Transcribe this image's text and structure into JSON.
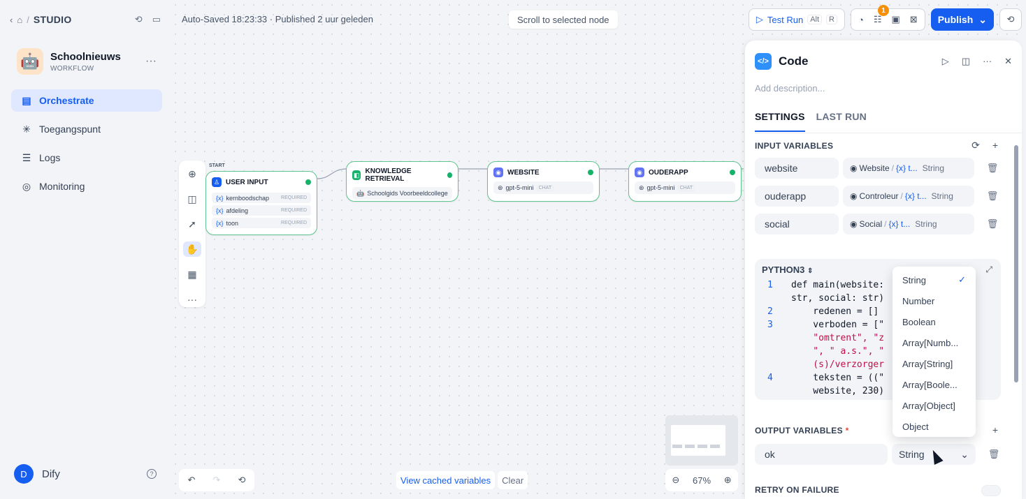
{
  "sidebar": {
    "studio_label": "STUDIO",
    "app": {
      "name": "Schoolnieuws",
      "type": "WORKFLOW",
      "emoji": "🤖"
    },
    "nav": [
      {
        "label": "Orchestrate",
        "icon": "orchestrate-icon",
        "active": true
      },
      {
        "label": "Toegangspunt",
        "icon": "access-point-icon",
        "active": false
      },
      {
        "label": "Logs",
        "icon": "logs-icon",
        "active": false
      },
      {
        "label": "Monitoring",
        "icon": "monitoring-icon",
        "active": false
      }
    ],
    "user": {
      "initial": "D",
      "name": "Dify"
    }
  },
  "topbar": {
    "status": "Auto-Saved 18:23:33 · Published 2 uur geleden",
    "scroll_to_node": "Scroll to selected node",
    "test_run": "Test Run",
    "kbd_alt": "Alt",
    "kbd_r": "R",
    "badge_count": "1",
    "publish": "Publish"
  },
  "canvas": {
    "start_label": "START",
    "nodes": {
      "user_input": {
        "title": "USER INPUT",
        "vars": [
          {
            "name": "kernboodschap",
            "req": "REQUIRED"
          },
          {
            "name": "afdeling",
            "req": "REQUIRED"
          },
          {
            "name": "toon",
            "req": "REQUIRED"
          }
        ]
      },
      "knowledge": {
        "title": "KNOWLEDGE RETRIEVAL",
        "sub": "Schoolgids Voorbeeldcollege"
      },
      "website": {
        "title": "WEBSITE",
        "model": "gpt-5-mini",
        "chip": "CHAT"
      },
      "ouderapp": {
        "title": "OUDERAPP",
        "model": "gpt-5-mini",
        "chip": "CHAT"
      }
    },
    "cache": {
      "view": "View cached variables",
      "clear": "Clear"
    },
    "zoom": "67%"
  },
  "panel": {
    "title": "Code",
    "description_placeholder": "Add description...",
    "tabs": [
      "SETTINGS",
      "LAST RUN"
    ],
    "input_label": "INPUT VARIABLES",
    "inputs": [
      {
        "name": "website",
        "node": "Website",
        "var": "{x} t...",
        "type": "String"
      },
      {
        "name": "ouderapp",
        "node": "Controleur",
        "var": "{x} t...",
        "type": "String"
      },
      {
        "name": "social",
        "node": "Social",
        "var": "{x} t...",
        "type": "String"
      }
    ],
    "code": {
      "language": "PYTHON3",
      "lines": [
        {
          "n": "1",
          "text": "def main(website:"
        },
        {
          "n": "",
          "text": "str, social: str)"
        },
        {
          "n": "2",
          "text": "    redenen = []"
        },
        {
          "n": "3",
          "text": "    verboden = [\""
        },
        {
          "n": "",
          "text": "    \"omtrent\", \"z"
        },
        {
          "n": "",
          "text": "    \", \" a.s.\", \""
        },
        {
          "n": "",
          "text": "    (s)/verzorger"
        },
        {
          "n": "4",
          "text": "    teksten = ((\""
        },
        {
          "n": "",
          "text": "    website, 230)"
        }
      ]
    },
    "output_label": "OUTPUT VARIABLES",
    "output_star": "*",
    "output": {
      "name": "ok",
      "type": "String"
    },
    "retry_label": "RETRY ON FAILURE"
  },
  "type_dropdown": {
    "selected": "String",
    "options": [
      "String",
      "Number",
      "Boolean",
      "Array[Numb...",
      "Array[String]",
      "Array[Boole...",
      "Array[Object]",
      "Object"
    ]
  },
  "colors": {
    "accent": "#155eef",
    "node_border": "#5fc48f",
    "success": "#17b26a",
    "badge": "#f79009"
  }
}
